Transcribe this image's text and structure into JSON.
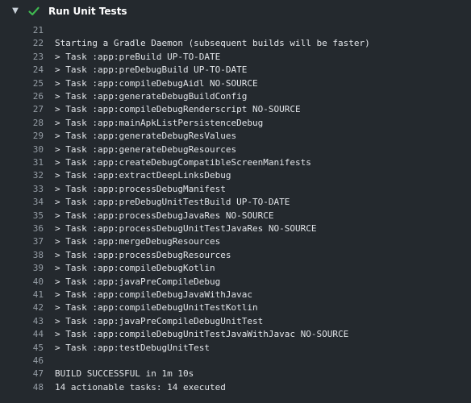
{
  "step": {
    "title": "Run Unit Tests",
    "status": "success",
    "expand_icon": "chevron-down-icon",
    "status_icon": "check-icon",
    "status_color": "#3fb950"
  },
  "log": {
    "lines": [
      {
        "num": "21",
        "text": ""
      },
      {
        "num": "22",
        "text": "Starting a Gradle Daemon (subsequent builds will be faster)"
      },
      {
        "num": "23",
        "text": "> Task :app:preBuild UP-TO-DATE"
      },
      {
        "num": "24",
        "text": "> Task :app:preDebugBuild UP-TO-DATE"
      },
      {
        "num": "25",
        "text": "> Task :app:compileDebugAidl NO-SOURCE"
      },
      {
        "num": "26",
        "text": "> Task :app:generateDebugBuildConfig"
      },
      {
        "num": "27",
        "text": "> Task :app:compileDebugRenderscript NO-SOURCE"
      },
      {
        "num": "28",
        "text": "> Task :app:mainApkListPersistenceDebug"
      },
      {
        "num": "29",
        "text": "> Task :app:generateDebugResValues"
      },
      {
        "num": "30",
        "text": "> Task :app:generateDebugResources"
      },
      {
        "num": "31",
        "text": "> Task :app:createDebugCompatibleScreenManifests"
      },
      {
        "num": "32",
        "text": "> Task :app:extractDeepLinksDebug"
      },
      {
        "num": "33",
        "text": "> Task :app:processDebugManifest"
      },
      {
        "num": "34",
        "text": "> Task :app:preDebugUnitTestBuild UP-TO-DATE"
      },
      {
        "num": "35",
        "text": "> Task :app:processDebugJavaRes NO-SOURCE"
      },
      {
        "num": "36",
        "text": "> Task :app:processDebugUnitTestJavaRes NO-SOURCE"
      },
      {
        "num": "37",
        "text": "> Task :app:mergeDebugResources"
      },
      {
        "num": "38",
        "text": "> Task :app:processDebugResources"
      },
      {
        "num": "39",
        "text": "> Task :app:compileDebugKotlin"
      },
      {
        "num": "40",
        "text": "> Task :app:javaPreCompileDebug"
      },
      {
        "num": "41",
        "text": "> Task :app:compileDebugJavaWithJavac"
      },
      {
        "num": "42",
        "text": "> Task :app:compileDebugUnitTestKotlin"
      },
      {
        "num": "43",
        "text": "> Task :app:javaPreCompileDebugUnitTest"
      },
      {
        "num": "44",
        "text": "> Task :app:compileDebugUnitTestJavaWithJavac NO-SOURCE"
      },
      {
        "num": "45",
        "text": "> Task :app:testDebugUnitTest"
      },
      {
        "num": "46",
        "text": ""
      },
      {
        "num": "47",
        "text": "BUILD SUCCESSFUL in 1m 10s"
      },
      {
        "num": "48",
        "text": "14 actionable tasks: 14 executed"
      }
    ]
  }
}
